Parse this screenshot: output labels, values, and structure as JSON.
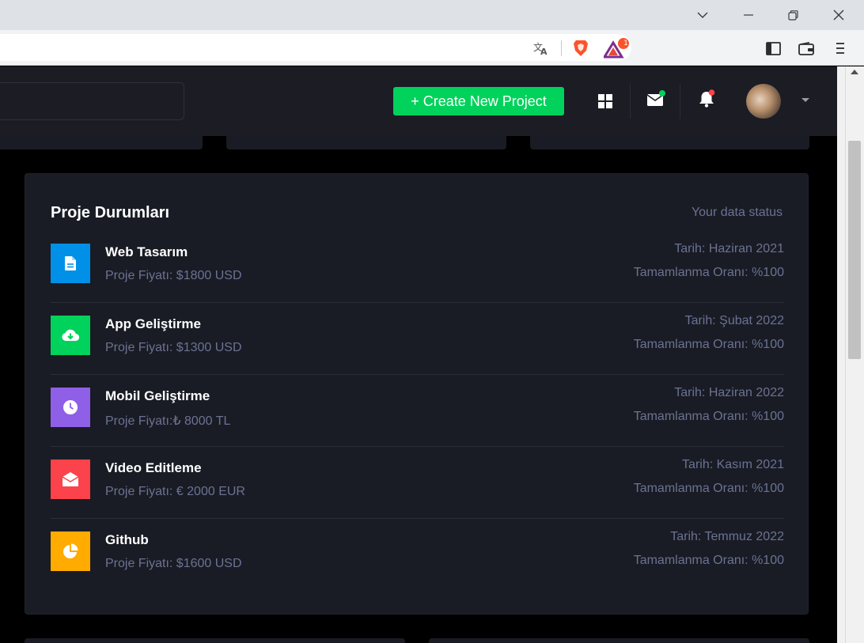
{
  "browser": {
    "icons": [
      "chevron-down-icon",
      "minimize-icon",
      "restore-icon",
      "close-icon",
      "translate-icon",
      "brave-shield-icon",
      "brave-rewards-icon",
      "sidebar-icon",
      "wallet-icon",
      "menu-icon"
    ],
    "rewards_badge": "1"
  },
  "navbar": {
    "create_button": "+ Create New Project",
    "icons": [
      "grid-icon",
      "mail-icon",
      "bell-icon"
    ],
    "accent": "#00d25b"
  },
  "card": {
    "title": "Proje Durumları",
    "subtitle": "Your data status",
    "items": [
      {
        "name": "Web Tasarım",
        "price": "Proje Fiyatı: $1800 USD",
        "date": "Tarih: Haziran 2021",
        "rate": "Tamamlanma Oranı: %100",
        "icon": "document-icon",
        "color": "#0090e7"
      },
      {
        "name": "App Geliştirme",
        "price": "Proje Fiyatı: $1300 USD",
        "date": "Tarih: Şubat 2022",
        "rate": "Tamamlanma Oranı: %100",
        "icon": "cloud-download-icon",
        "color": "#00d25b"
      },
      {
        "name": "Mobil Geliştirme",
        "price": "Proje Fiyatı:₺ 8000 TL",
        "date": "Tarih: Haziran 2022",
        "rate": "Tamamlanma Oranı: %100",
        "icon": "clock-icon",
        "color": "#8f5fe8"
      },
      {
        "name": "Video Editleme",
        "price": "Proje Fiyatı: € 2000 EUR",
        "date": "Tarih: Kasım 2021",
        "rate": "Tamamlanma Oranı: %100",
        "icon": "email-open-icon",
        "color": "#fc424a"
      },
      {
        "name": "Github",
        "price": "Proje Fiyatı: $1600 USD",
        "date": "Tarih: Temmuz 2022",
        "rate": "Tamamlanma Oranı: %100",
        "icon": "pie-chart-icon",
        "color": "#ffab00"
      }
    ]
  }
}
